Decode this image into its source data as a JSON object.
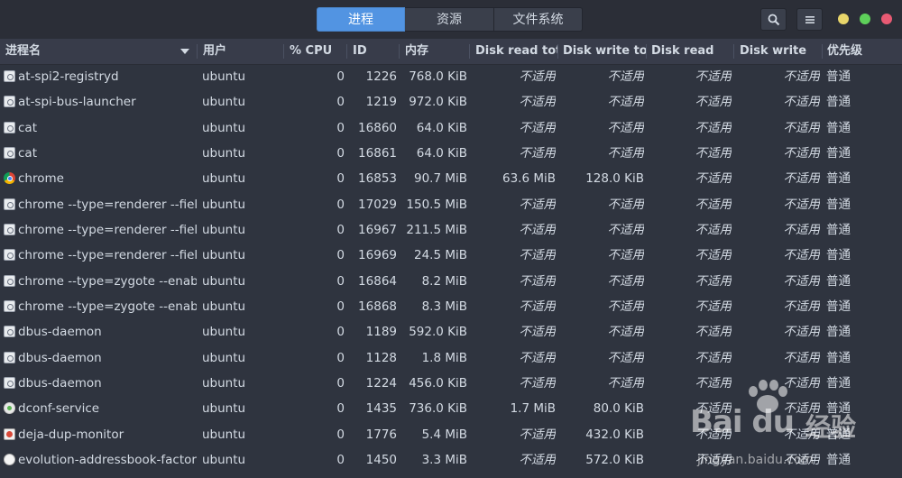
{
  "header": {
    "tabs": [
      {
        "label": "进程",
        "active": true
      },
      {
        "label": "资源",
        "active": false
      },
      {
        "label": "文件系统",
        "active": false
      }
    ],
    "search_icon": "search-icon",
    "menu_icon": "hamburger-menu-icon",
    "window_controls": [
      {
        "name": "minimize",
        "color": "#e8d56a"
      },
      {
        "name": "maximize",
        "color": "#5ed05a"
      },
      {
        "name": "close",
        "color": "#e85a73"
      }
    ]
  },
  "columns": {
    "name": "进程名",
    "user": "用户",
    "cpu": "% CPU",
    "id": "ID",
    "memory": "内存",
    "disk_read_total": "Disk read tot",
    "disk_write_total": "Disk write to",
    "disk_read": "Disk read",
    "disk_write": "Disk write",
    "priority": "优先级"
  },
  "rows": [
    {
      "icon": "generic",
      "name": "at-spi2-registryd",
      "user": "ubuntu",
      "cpu": "0",
      "id": "1226",
      "memory": "768.0 KiB",
      "drt": "不适用",
      "dwt": "不适用",
      "dr": "不适用",
      "dw": "不适用",
      "priority": "普通"
    },
    {
      "icon": "generic",
      "name": "at-spi-bus-launcher",
      "user": "ubuntu",
      "cpu": "0",
      "id": "1219",
      "memory": "972.0 KiB",
      "drt": "不适用",
      "dwt": "不适用",
      "dr": "不适用",
      "dw": "不适用",
      "priority": "普通"
    },
    {
      "icon": "generic",
      "name": "cat",
      "user": "ubuntu",
      "cpu": "0",
      "id": "16860",
      "memory": "64.0 KiB",
      "drt": "不适用",
      "dwt": "不适用",
      "dr": "不适用",
      "dw": "不适用",
      "priority": "普通"
    },
    {
      "icon": "generic",
      "name": "cat",
      "user": "ubuntu",
      "cpu": "0",
      "id": "16861",
      "memory": "64.0 KiB",
      "drt": "不适用",
      "dwt": "不适用",
      "dr": "不适用",
      "dw": "不适用",
      "priority": "普通"
    },
    {
      "icon": "chrome",
      "name": "chrome",
      "user": "ubuntu",
      "cpu": "0",
      "id": "16853",
      "memory": "90.7 MiB",
      "drt": "63.6 MiB",
      "dwt": "128.0 KiB",
      "dr": "不适用",
      "dw": "不适用",
      "priority": "普通"
    },
    {
      "icon": "generic",
      "name": "chrome --type=renderer --field-",
      "user": "ubuntu",
      "cpu": "0",
      "id": "17029",
      "memory": "150.5 MiB",
      "drt": "不适用",
      "dwt": "不适用",
      "dr": "不适用",
      "dw": "不适用",
      "priority": "普通"
    },
    {
      "icon": "generic",
      "name": "chrome --type=renderer --field-",
      "user": "ubuntu",
      "cpu": "0",
      "id": "16967",
      "memory": "211.5 MiB",
      "drt": "不适用",
      "dwt": "不适用",
      "dr": "不适用",
      "dw": "不适用",
      "priority": "普通"
    },
    {
      "icon": "generic",
      "name": "chrome --type=renderer --field-",
      "user": "ubuntu",
      "cpu": "0",
      "id": "16969",
      "memory": "24.5 MiB",
      "drt": "不适用",
      "dwt": "不适用",
      "dr": "不适用",
      "dw": "不适用",
      "priority": "普通"
    },
    {
      "icon": "generic",
      "name": "chrome --type=zygote --enable-",
      "user": "ubuntu",
      "cpu": "0",
      "id": "16864",
      "memory": "8.2 MiB",
      "drt": "不适用",
      "dwt": "不适用",
      "dr": "不适用",
      "dw": "不适用",
      "priority": "普通"
    },
    {
      "icon": "generic",
      "name": "chrome --type=zygote --enable-",
      "user": "ubuntu",
      "cpu": "0",
      "id": "16868",
      "memory": "8.3 MiB",
      "drt": "不适用",
      "dwt": "不适用",
      "dr": "不适用",
      "dw": "不适用",
      "priority": "普通"
    },
    {
      "icon": "generic",
      "name": "dbus-daemon",
      "user": "ubuntu",
      "cpu": "0",
      "id": "1189",
      "memory": "592.0 KiB",
      "drt": "不适用",
      "dwt": "不适用",
      "dr": "不适用",
      "dw": "不适用",
      "priority": "普通"
    },
    {
      "icon": "generic",
      "name": "dbus-daemon",
      "user": "ubuntu",
      "cpu": "0",
      "id": "1128",
      "memory": "1.8 MiB",
      "drt": "不适用",
      "dwt": "不适用",
      "dr": "不适用",
      "dw": "不适用",
      "priority": "普通"
    },
    {
      "icon": "generic",
      "name": "dbus-daemon",
      "user": "ubuntu",
      "cpu": "0",
      "id": "1224",
      "memory": "456.0 KiB",
      "drt": "不适用",
      "dwt": "不适用",
      "dr": "不适用",
      "dw": "不适用",
      "priority": "普通"
    },
    {
      "icon": "dconf",
      "name": "dconf-service",
      "user": "ubuntu",
      "cpu": "0",
      "id": "1435",
      "memory": "736.0 KiB",
      "drt": "1.7 MiB",
      "dwt": "80.0 KiB",
      "dr": "不适用",
      "dw": "不适用",
      "priority": "普通"
    },
    {
      "icon": "deja",
      "name": "deja-dup-monitor",
      "user": "ubuntu",
      "cpu": "0",
      "id": "1776",
      "memory": "5.4 MiB",
      "drt": "不适用",
      "dwt": "432.0 KiB",
      "dr": "不适用",
      "dw": "不适用",
      "priority": "普通"
    },
    {
      "icon": "evo",
      "name": "evolution-addressbook-factor",
      "user": "ubuntu",
      "cpu": "0",
      "id": "1450",
      "memory": "3.3 MiB",
      "drt": "不适用",
      "dwt": "572.0 KiB",
      "dr": "不适用",
      "dw": "不适用",
      "priority": "普通"
    }
  ],
  "watermark": {
    "logo": "Bai du",
    "cn": "经验",
    "url": "jingyan.baidu.com"
  }
}
